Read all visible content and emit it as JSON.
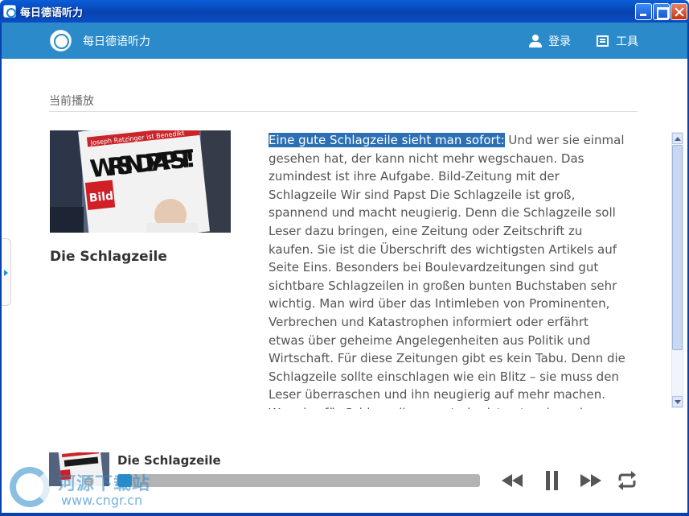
{
  "window": {
    "title": "每日德语听力"
  },
  "header": {
    "app_name": "每日德语听力",
    "login_label": "登录",
    "tools_label": "工具"
  },
  "section": {
    "label": "当前播放"
  },
  "episode": {
    "title": "Die Schlagzeile",
    "cover_headline": "WIR SIND PAPST!",
    "cover_masthead": "Bild",
    "cover_strip": "Joseph Ratzinger ist Benedikt"
  },
  "article": {
    "highlight": "Eine gute Schlagzeile sieht man sofort:",
    "body": " Und wer sie einmal gesehen hat, der kann nicht mehr wegschauen. Das zumindest ist ihre Aufgabe. Bild-Zeitung mit der Schlagzeile Wir sind Papst Die Schlagzeile ist groß, spannend und macht neugierig. Denn die Schlagzeile soll Leser dazu bringen, eine Zeitung oder Zeitschrift zu kaufen. Sie ist die Überschrift des wichtigsten Artikels auf Seite Eins. Besonders bei Boulevardzeitungen sind gut sichtbare Schlagzeilen in großen bunten Buchstaben sehr wichtig. Man wird über das Intimleben von Prominenten, Verbrechen und Katastrophen informiert oder erfährt etwas über geheime Angelegenheiten aus Politik und Wirtschaft. Für diese Zeitungen gibt es kein Tabu. Denn die Schlagzeile sollte einschlagen wie ein Blitz – sie muss den Leser überraschen und ihn neugierig auf mehr machen. Wer also für Schlagzeilen sorgt, der ist entweder sehr berühmt oder hat einen seltsamen Skandal verursacht."
  },
  "player": {
    "title": "Die Schlagzeile",
    "progress": 0.0
  },
  "watermark": {
    "cn": "河源下载站",
    "url": "www.cngr.cn"
  },
  "colors": {
    "accent": "#2b8ac9",
    "titlebar": "#0842b0",
    "highlight": "#2b6fb5"
  }
}
